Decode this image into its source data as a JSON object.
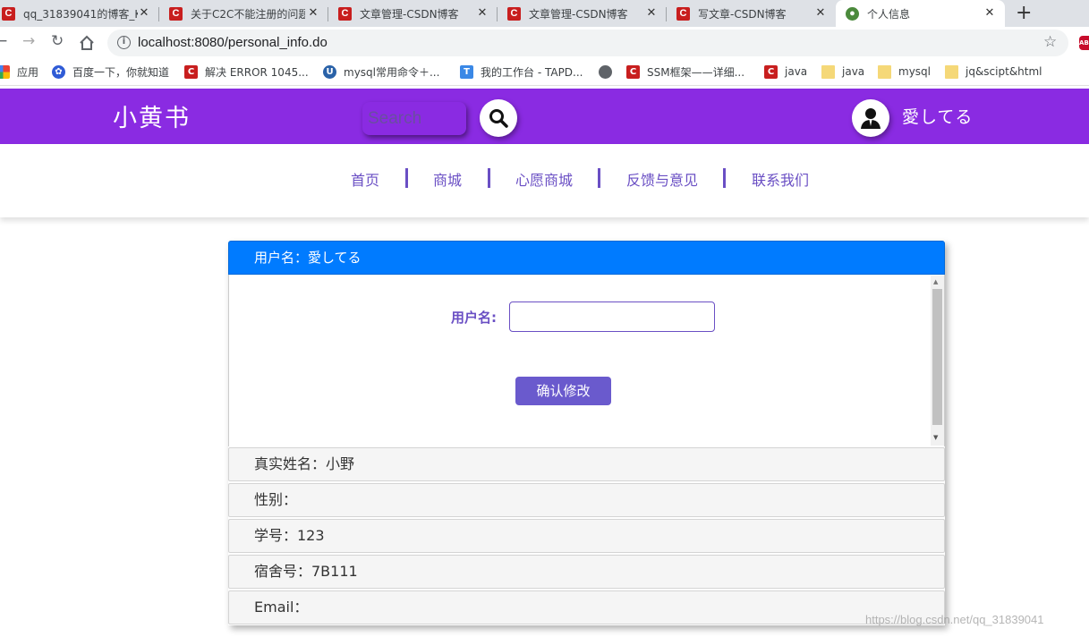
{
  "browser": {
    "tabs": [
      {
        "title": "qq_31839041的博客_K",
        "favicon": "csdn-icon",
        "active": false
      },
      {
        "title": "关于C2C不能注册的问题",
        "favicon": "csdn-icon",
        "active": false
      },
      {
        "title": "文章管理-CSDN博客",
        "favicon": "csdn-icon",
        "active": false
      },
      {
        "title": "文章管理-CSDN博客",
        "favicon": "csdn-icon",
        "active": false
      },
      {
        "title": "写文章-CSDN博客",
        "favicon": "csdn-icon",
        "active": false
      },
      {
        "title": "个人信息",
        "favicon": "site-icon",
        "active": true
      }
    ],
    "url": "localhost:8080/personal_info.do",
    "bookmarks": [
      {
        "label": "应用",
        "icon": "apps-icon"
      },
      {
        "label": "百度一下，你就知道",
        "icon": "baidu-icon"
      },
      {
        "label": "解决 ERROR 1045...",
        "icon": "csdn-icon"
      },
      {
        "label": "mysql常用命令＋...",
        "icon": "u-icon"
      },
      {
        "label": "我的工作台 - TAPD...",
        "icon": "tapd-icon"
      },
      {
        "label": "SSM框架——详细...",
        "icon": "csdn-icon"
      },
      {
        "label": "java",
        "icon": "csdn-icon"
      },
      {
        "label": "java",
        "icon": "folder-icon"
      },
      {
        "label": "mysql",
        "icon": "folder-icon"
      },
      {
        "label": "jq&scipt&html",
        "icon": "folder-icon"
      }
    ]
  },
  "header": {
    "logo": "小黄书",
    "search_placeholder": "Search",
    "username": "愛してる",
    "brand_color": "#8a2be2"
  },
  "nav": {
    "items": [
      "首页",
      "商城",
      "心愿商城",
      "反馈与意见",
      "联系我们"
    ]
  },
  "panel": {
    "header": "用户名：愛してる",
    "field_label": "用户名:",
    "field_value": "",
    "confirm_label": "确认修改",
    "rows": [
      "真实姓名：小野",
      "性别：",
      "学号：123",
      "宿舍号：7B111",
      "Email："
    ]
  },
  "watermark": "https://blog.csdn.net/qq_31839041"
}
